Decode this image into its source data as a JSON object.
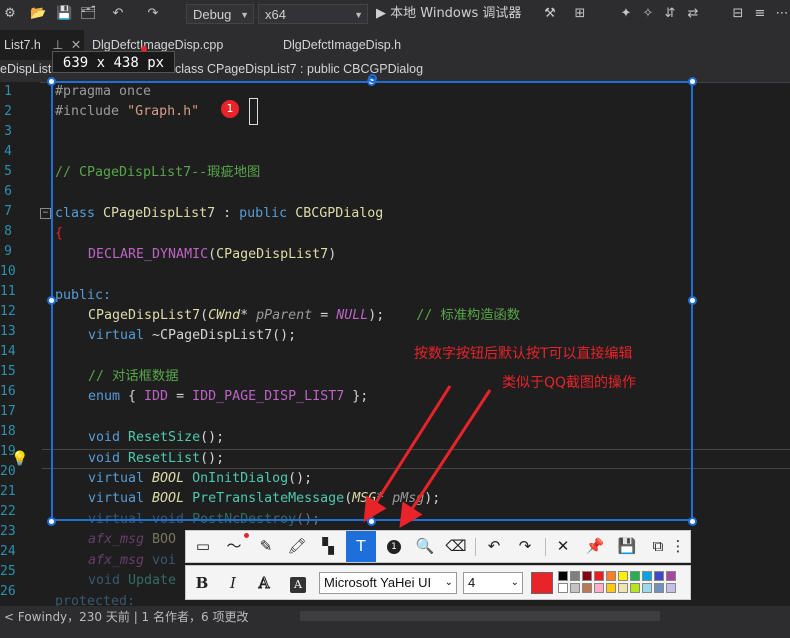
{
  "toolbar": {
    "config": "Debug",
    "platform": "x64",
    "run_label": "▶ 本地 Windows 调试器"
  },
  "tabs": [
    {
      "label": "List7.h"
    },
    {
      "label": "DlgDefctImageDisp.cpp"
    },
    {
      "label": "DlgDefctImageDisp.h"
    }
  ],
  "nav": {
    "left": "eDispList",
    "scope": "class CPageDispList7 : public CBCGPDialog"
  },
  "size_badge": "639 x 438 px",
  "code": {
    "l1a": "#pragma once",
    "l2a": "#include ",
    "l2b": "\"Graph.h\"",
    "l5": "// CPageDispList7--瑕疵地图",
    "l7a": "class ",
    "l7b": "CPageDispList7",
    "l7c": " : ",
    "l7d": "public ",
    "l7e": "CBCGPDialog",
    "l8": "{",
    "l9a": "DECLARE_DYNAMIC",
    "l9b": "(",
    "l9c": "CPageDispList7",
    "l9d": ")",
    "l11": "public:",
    "l12a": "CPageDispList7",
    "l12b": "(",
    "l12c": "CWnd",
    "l12d": "* ",
    "l12e": "pParent",
    "l12f": " = ",
    "l12g": "NULL",
    "l12h": ");    ",
    "l12i": "// 标准构造函数",
    "l13a": "virtual ",
    "l13b": "~CPageDispList7",
    "l13c": "();",
    "l15": "// 对话框数据",
    "l16a": "enum ",
    "l16b": "{ ",
    "l16c": "IDD",
    "l16d": " = ",
    "l16e": "IDD_PAGE_DISP_LIST7",
    "l16f": " };",
    "l18a": "void ",
    "l18b": "ResetSize",
    "l18c": "();",
    "l19a": "void ",
    "l19b": "ResetList",
    "l19c": "();",
    "l20a": "virtual ",
    "l20b": "BOOL ",
    "l20c": "OnInitDialog",
    "l20d": "();",
    "l21a": "virtual ",
    "l21b": "BOOL ",
    "l21c": "PreTranslateMessage",
    "l21d": "(",
    "l21e": "MSG",
    "l21f": "* ",
    "l21g": "pMsg",
    "l21h": ");",
    "l22a": "virtual void ",
    "l22b": "PostNcDestroy",
    "l22c": "();",
    "l23a": "afx_msg ",
    "l23b": "BOO",
    "l24a": "afx_msg ",
    "l24b": "voi",
    "l25a": "void ",
    "l25b": "Update",
    "l26": "protected:"
  },
  "line_numbers": [
    "1",
    "2",
    "3",
    "4",
    "5",
    "6",
    "7",
    "8",
    "9",
    "10",
    "11",
    "12",
    "13",
    "14",
    "15",
    "16",
    "17",
    "18",
    "19",
    "20",
    "21",
    "22",
    "23",
    "24",
    "25",
    "26"
  ],
  "annotations": {
    "note1": "按数字按钮后默认按T可以直接编辑",
    "note2": "类似于QQ截图的操作",
    "marker": "1"
  },
  "annot_toolbar": {
    "number_label": "1",
    "text_label": "T"
  },
  "font_toolbar": {
    "bold": "B",
    "italic": "I",
    "outline": "A",
    "filled": "A",
    "font": "Microsoft YaHei UI",
    "size": "4"
  },
  "palette": {
    "selected": "#e8232a",
    "colors": [
      "#000000",
      "#7f7f7f",
      "#880015",
      "#ed1c24",
      "#ff7f27",
      "#fff200",
      "#22b14c",
      "#00a2e8",
      "#3f48cc",
      "#a349a4",
      "#ffffff",
      "#c3c3c3",
      "#b97a57",
      "#ffaec9",
      "#ffc90e",
      "#efe4b0",
      "#b5e61d",
      "#99d9ea",
      "#7092be",
      "#c8bfe7"
    ]
  },
  "status": {
    "text": "< Fowindy，230 天前 | 1 名作者，6 项更改"
  }
}
